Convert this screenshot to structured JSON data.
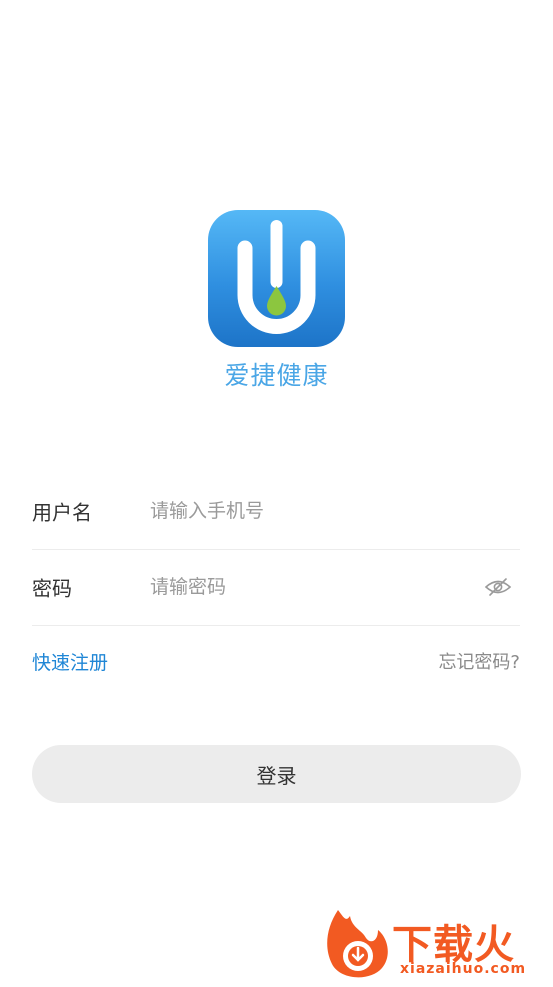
{
  "app": {
    "name": "爱捷健康",
    "logo_icon": "water-drop-u-logo",
    "brand_color": "#2f8fe0"
  },
  "login_form": {
    "username": {
      "label": "用户名",
      "placeholder": "请输入手机号",
      "value": ""
    },
    "password": {
      "label": "密码",
      "placeholder": "请输密码",
      "value": "",
      "toggle_icon": "eye-off-icon"
    },
    "register_link": "快速注册",
    "forgot_link": "忘记密码?",
    "submit_label": "登录",
    "link_color": "#1f86d6"
  },
  "watermark": {
    "logo_text": "下载火",
    "domain_text": "xiazaihuo.com",
    "color": "#f25a22"
  }
}
